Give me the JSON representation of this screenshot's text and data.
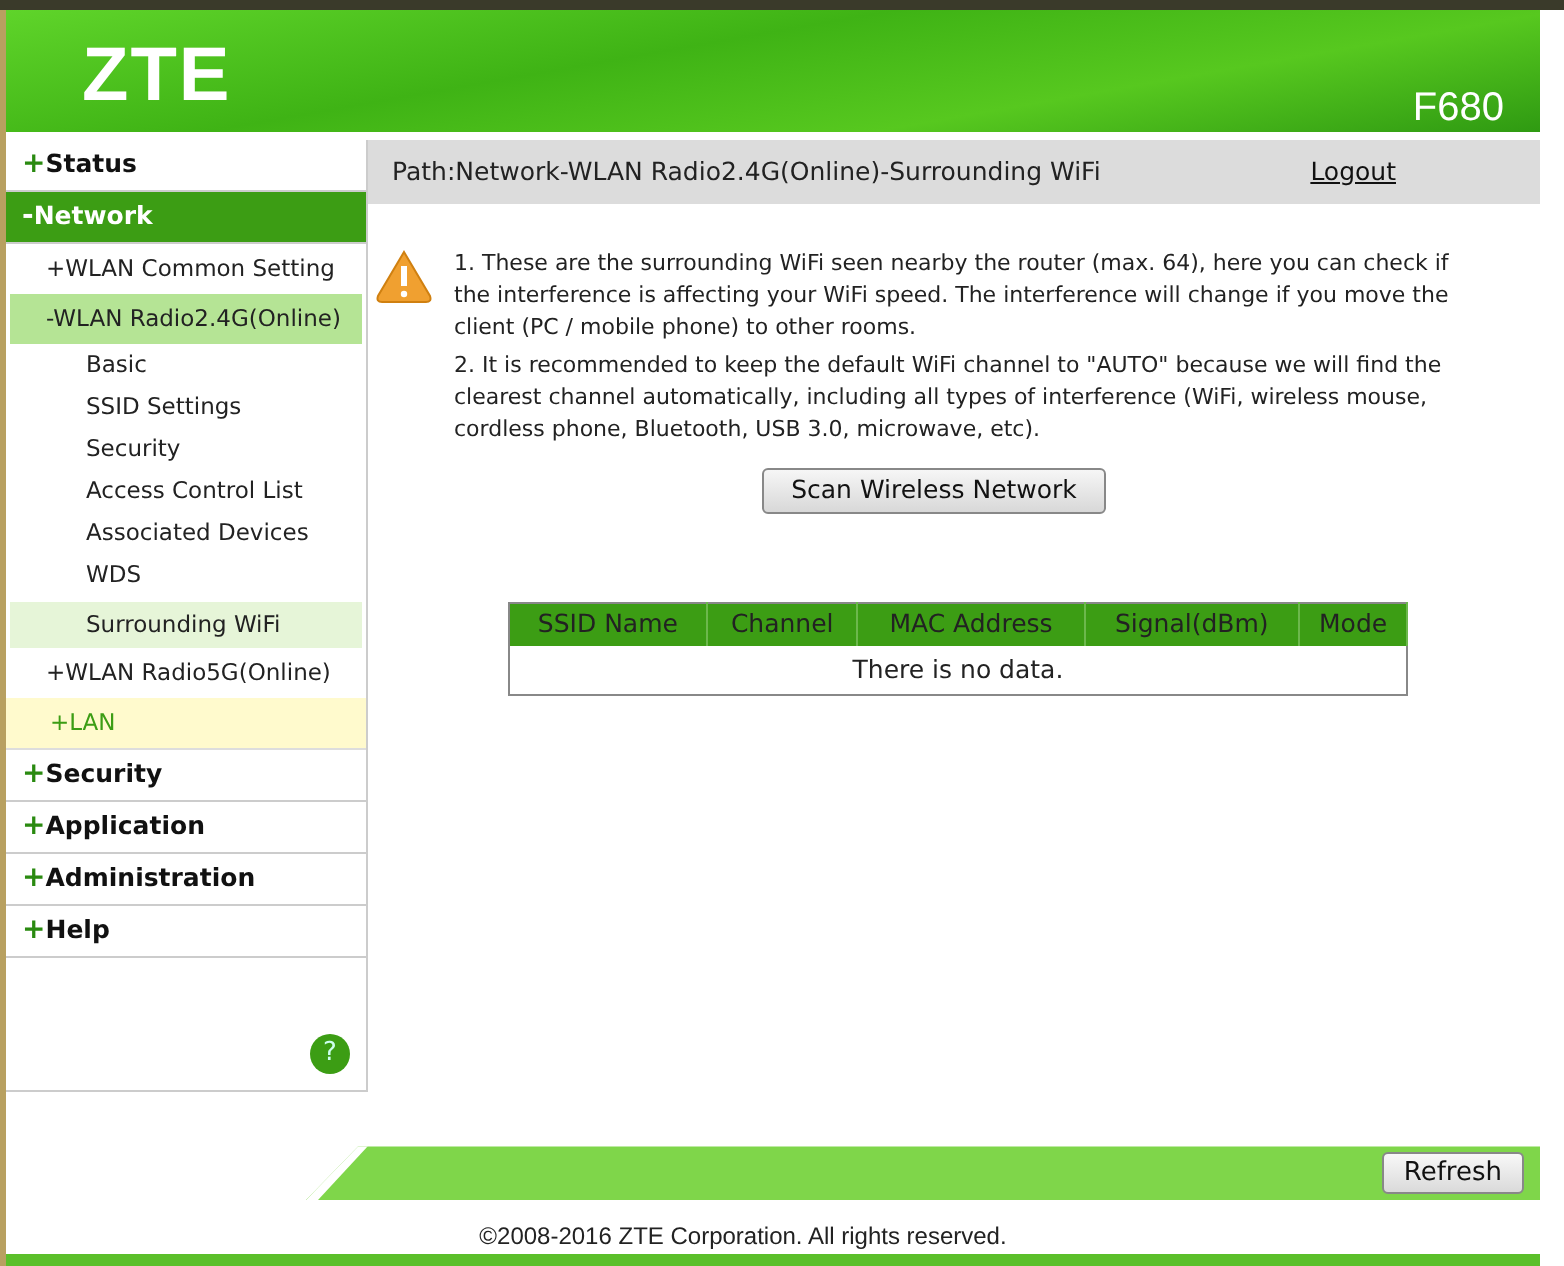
{
  "header": {
    "brand": "ZTE",
    "model": "F680"
  },
  "sidebar": {
    "items": [
      {
        "prefix": "+",
        "label": "Status",
        "expanded": false,
        "selected": false,
        "hovered": false
      },
      {
        "prefix": "-",
        "label": "Network",
        "expanded": true,
        "selected": false,
        "hovered": false,
        "children": [
          {
            "prefix": "+",
            "label": "WLAN Common Setting",
            "expanded": false,
            "selected": false,
            "hovered": false
          },
          {
            "prefix": "-",
            "label": "WLAN Radio2.4G(Online)",
            "expanded": true,
            "selected": false,
            "hovered": false,
            "children": [
              {
                "label": "Basic",
                "selected": false
              },
              {
                "label": "SSID Settings",
                "selected": false
              },
              {
                "label": "Security",
                "selected": false
              },
              {
                "label": "Access Control List",
                "selected": false
              },
              {
                "label": "Associated Devices",
                "selected": false
              },
              {
                "label": "WDS",
                "selected": false
              },
              {
                "label": "Surrounding WiFi",
                "selected": true
              }
            ]
          },
          {
            "prefix": "+",
            "label": "WLAN Radio5G(Online)",
            "expanded": false,
            "selected": false,
            "hovered": false
          },
          {
            "prefix": "+",
            "label": "LAN",
            "expanded": false,
            "selected": false,
            "hovered": true
          }
        ]
      },
      {
        "prefix": "+",
        "label": "Security",
        "expanded": false,
        "selected": false,
        "hovered": false
      },
      {
        "prefix": "+",
        "label": "Application",
        "expanded": false,
        "selected": false,
        "hovered": false
      },
      {
        "prefix": "+",
        "label": "Administration",
        "expanded": false,
        "selected": false,
        "hovered": false
      },
      {
        "prefix": "+",
        "label": "Help",
        "expanded": false,
        "selected": false,
        "hovered": false
      }
    ],
    "help_icon": "?"
  },
  "path_bar": {
    "path": "Path:Network-WLAN Radio2.4G(Online)-Surrounding WiFi",
    "logout": "Logout"
  },
  "notes": [
    "1. These are the surrounding WiFi seen nearby the router (max. 64), here you can check if the interference is affecting your WiFi speed. The interference will change if you move the client (PC / mobile phone) to other rooms.",
    "2. It is recommended to keep the default WiFi channel to \"AUTO\" because we will find the clearest channel automatically, including all types of interference (WiFi, wireless mouse, cordless phone, Bluetooth, USB 3.0, microwave, etc)."
  ],
  "scan_button": "Scan Wireless Network",
  "table": {
    "columns": [
      "SSID Name",
      "Channel",
      "MAC Address",
      "Signal(dBm)",
      "Mode"
    ],
    "empty_message": "There is no data."
  },
  "refresh_button": "Refresh",
  "footer": "©2008-2016 ZTE Corporation. All rights reserved."
}
